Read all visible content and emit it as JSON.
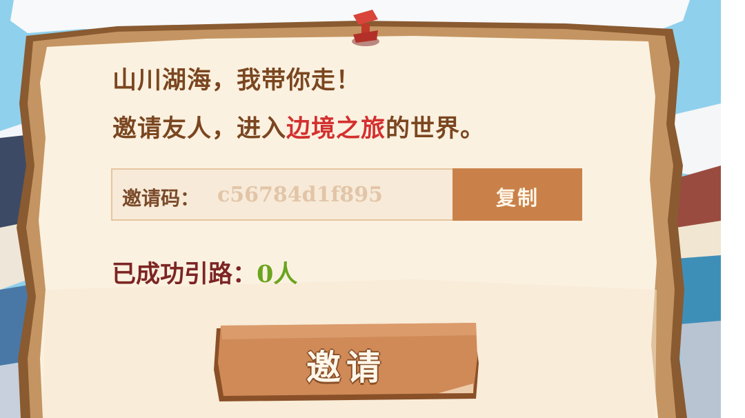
{
  "intro": {
    "line1": "山川湖海，我带你走！",
    "line2_prefix": "邀请友人，进入",
    "line2_highlight": "边境之旅",
    "line2_suffix": "的世界。"
  },
  "invite_code": {
    "label": "邀请码：",
    "value": "c56784d1f895",
    "copy_label": "复制"
  },
  "guided": {
    "label": "已成功引路：",
    "count": "0",
    "unit": "人"
  },
  "invite_button": {
    "label": "邀请"
  },
  "colors": {
    "parchment": "#fbf1e0",
    "wood": "#c98149",
    "title_text": "#7a4620",
    "highlight_text": "#d3302f",
    "guided_label": "#7c2524",
    "guided_value": "#6aa51e"
  }
}
